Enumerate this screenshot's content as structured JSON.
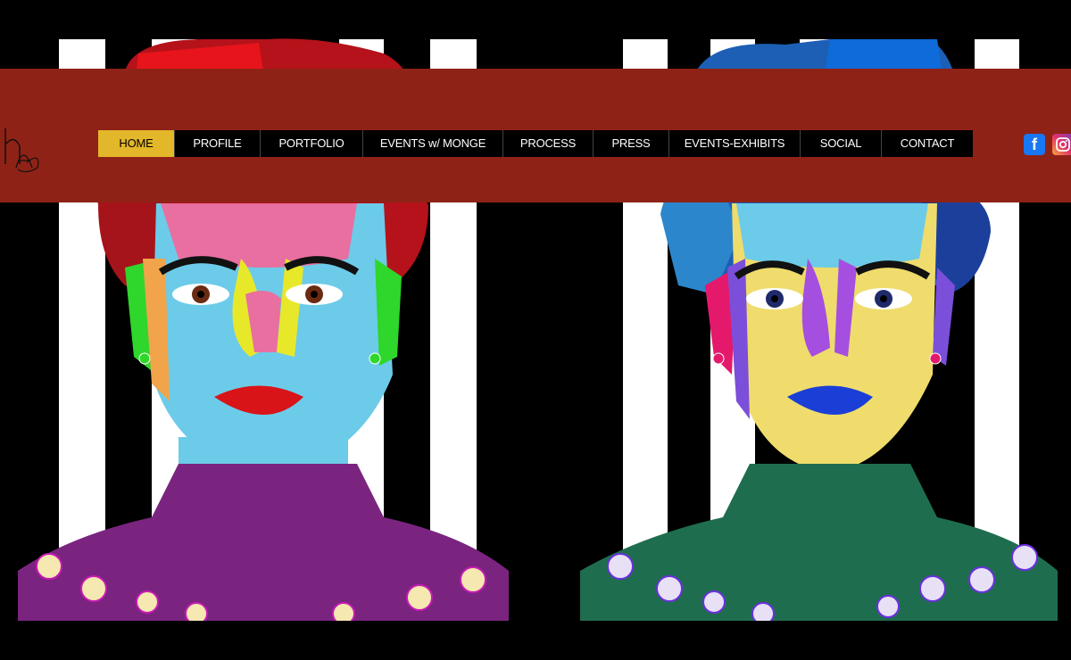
{
  "site": {
    "logo_text": "h"
  },
  "nav": {
    "items": [
      {
        "label": "HOME",
        "active": true
      },
      {
        "label": "PROFILE"
      },
      {
        "label": "PORTFOLIO"
      },
      {
        "label": "EVENTS w/ MONGE"
      },
      {
        "label": "PROCESS"
      },
      {
        "label": "PRESS"
      },
      {
        "label": "EVENTS-EXHIBITS"
      },
      {
        "label": "SOCIAL"
      },
      {
        "label": "CONTACT"
      }
    ]
  },
  "social": {
    "facebook_icon": "facebook-icon",
    "instagram_icon": "instagram-icon",
    "facebook_letter": "f"
  },
  "colors": {
    "header_band": "#8f2216",
    "nav_active": "#e2b72a",
    "nav_bg": "#000000"
  },
  "artworks": [
    {
      "name": "pop-art-portrait-red"
    },
    {
      "name": "pop-art-portrait-blue"
    }
  ]
}
